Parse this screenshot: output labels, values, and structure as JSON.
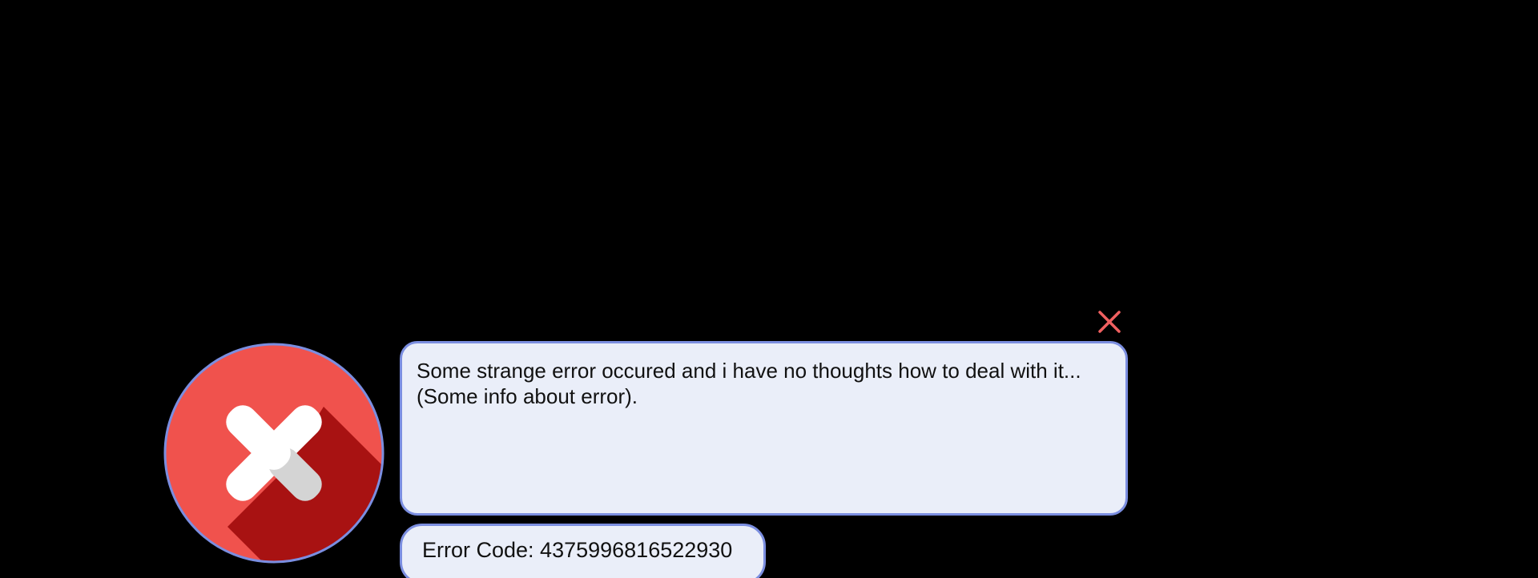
{
  "dialog": {
    "icon": "error-x-icon",
    "close_icon": "close-icon",
    "message_line_1": "Some strange error occured and i have no thoughts how to deal with it...",
    "message_line_2": "(Some info about error).",
    "error_code": "Error Code: 4375996816522930"
  },
  "colors": {
    "background": "#000000",
    "panel_fill": "#eaeef9",
    "panel_border": "#7b8ee0",
    "icon_red": "#f0524d",
    "icon_shadow": "#a81212",
    "close_red": "#f06060"
  }
}
